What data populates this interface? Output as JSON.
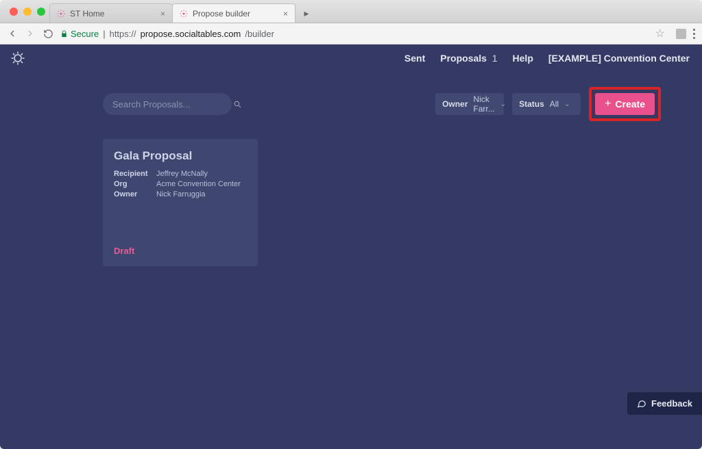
{
  "browser": {
    "tabs": [
      {
        "title": "ST Home",
        "active": false
      },
      {
        "title": "Propose builder",
        "active": true
      }
    ],
    "secure_label": "Secure",
    "url_scheme": "https://",
    "url_host": "propose.socialtables.com",
    "url_path": "/builder"
  },
  "nav": {
    "sent": "Sent",
    "proposals": "Proposals",
    "proposals_count": "1",
    "help": "Help",
    "org": "[EXAMPLE] Convention Center"
  },
  "search": {
    "placeholder": "Search Proposals..."
  },
  "filters": {
    "owner_label": "Owner",
    "owner_value": "Nick Farr...",
    "status_label": "Status",
    "status_value": "All"
  },
  "create_label": "Create",
  "card": {
    "title": "Gala Proposal",
    "recipient_label": "Recipient",
    "recipient": "Jeffrey McNally",
    "org_label": "Org",
    "org": "Acme Convention Center",
    "owner_label": "Owner",
    "owner": "Nick Farruggia",
    "status": "Draft"
  },
  "feedback_label": "Feedback"
}
